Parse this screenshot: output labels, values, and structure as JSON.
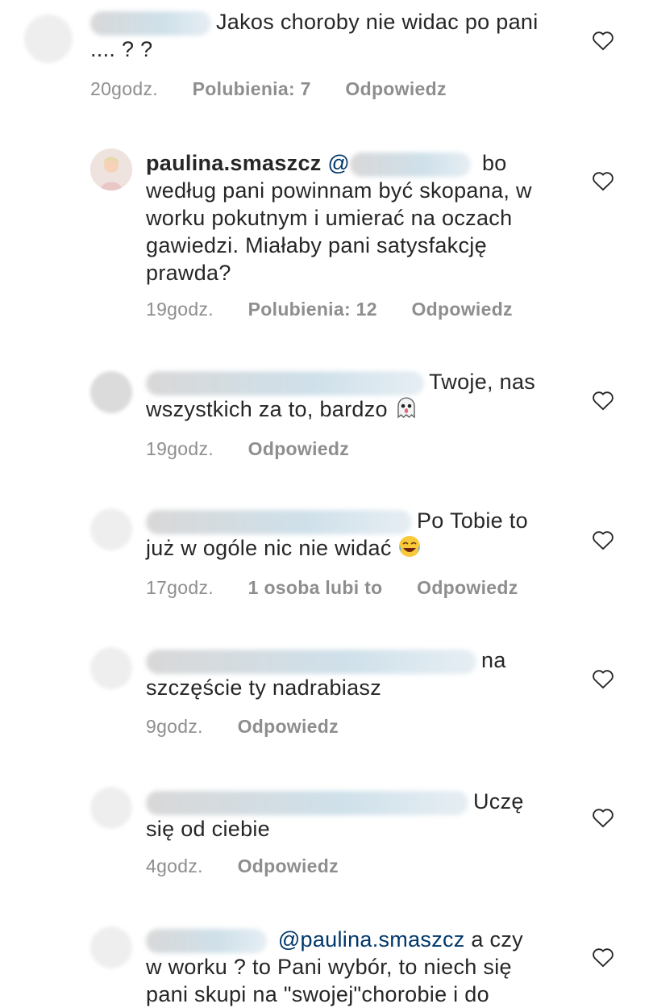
{
  "comments": [
    {
      "text": "Jakos choroby nie widac po pani .... ? ?",
      "time": "20godz.",
      "likes": "Polubienia: 7",
      "reply": "Odpowiedz"
    },
    {
      "username": "paulina.smaszcz",
      "mention_prefix": "@",
      "text_after": "bo według pani powinnam być skopana, w worku pokutnym i umierać na oczach gawiedzi. Miałaby pani satysfakcję prawda?",
      "time": "19godz.",
      "likes": "Polubienia: 12",
      "reply": "Odpowiedz"
    },
    {
      "text_line1": "Twoje, nas",
      "text_line2": "wszystkich za to, bardzo",
      "emoji": "ghost-emoji",
      "time": "19godz.",
      "reply": "Odpowiedz"
    },
    {
      "text_line1": "Po Tobie to",
      "text_line2": "już w ogóle nic nie widać",
      "emoji": "laughing-emoji",
      "time": "17godz.",
      "likes": "1 osoba lubi to",
      "reply": "Odpowiedz"
    },
    {
      "text_line1": "na",
      "text_line2": "szczęście ty nadrabiasz",
      "time": "9godz.",
      "reply": "Odpowiedz"
    },
    {
      "text_line1": "Uczę",
      "text_line2": "się od ciebie",
      "time": "4godz.",
      "reply": "Odpowiedz"
    },
    {
      "mention": "@paulina.smaszcz",
      "text_line1": "a czy",
      "text_line2": "w worku ? to Pani wybór, to niech się",
      "text_line3": "pani skupi na \"swojej\"chorobie i do"
    }
  ],
  "colors": {
    "text": "#262626",
    "meta": "#8e8e8e",
    "mention": "#00376b"
  }
}
